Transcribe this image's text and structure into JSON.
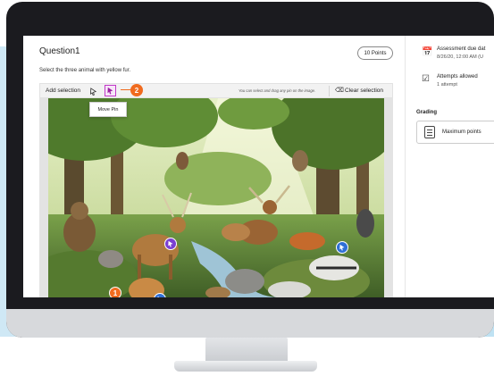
{
  "question": {
    "title": "Question1",
    "points": "10 Points",
    "prompt": "Select the three animal with yellow fur."
  },
  "toolbar": {
    "add_selection": "Add selection",
    "hint": "You can select and drag any pin on the image.",
    "clear_selection": "Clear selection",
    "step_badge": "2",
    "tooltip": "Move Pin"
  },
  "scene": {
    "pins": [
      {
        "label": "1",
        "color": "#f06b1f"
      },
      {
        "label": "",
        "color": "#2f6fd6"
      },
      {
        "label": "",
        "color": "#7a3fd1"
      },
      {
        "label": "",
        "color": "#2f6fd6"
      }
    ]
  },
  "sidebar": {
    "assessment_due_label": "Assessment due dat",
    "assessment_due_value": "8/26/20, 12:00 AM (U",
    "attempts_label": "Attempts allowed",
    "attempts_value": "1 attempt",
    "grading_heading": "Grading",
    "maximum_points": "Maximum points"
  },
  "colors": {
    "accent_orange": "#f06b1f",
    "move_pin_purple": "#c238c9",
    "pin_blue": "#2f6fd6",
    "pin_purple": "#7a3fd1"
  },
  "icons": [
    "select-pin-icon",
    "move-pin-icon",
    "clear-icon",
    "calendar-icon",
    "checkbox-icon",
    "list-icon"
  ]
}
